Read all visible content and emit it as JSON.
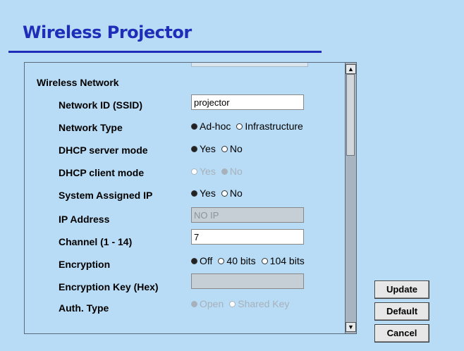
{
  "header": {
    "title": "Wireless Projector"
  },
  "section": {
    "heading": "Wireless Network"
  },
  "fields": {
    "ssid": {
      "label": "Network ID (SSID)",
      "value": "projector"
    },
    "network_type": {
      "label": "Network Type",
      "options": [
        "Ad-hoc",
        "Infrastructure"
      ],
      "selected": "Ad-hoc"
    },
    "dhcp_server": {
      "label": "DHCP server mode",
      "options": [
        "Yes",
        "No"
      ],
      "selected": "Yes"
    },
    "dhcp_client": {
      "label": "DHCP client mode",
      "options": [
        "Yes",
        "No"
      ],
      "selected": "No",
      "disabled": true
    },
    "system_ip": {
      "label": "System Assigned IP",
      "options": [
        "Yes",
        "No"
      ],
      "selected": "Yes"
    },
    "ip_address": {
      "label": "IP Address",
      "value": "NO IP",
      "disabled": true
    },
    "channel": {
      "label": "Channel (1 - 14)",
      "value": "7"
    },
    "encryption": {
      "label": "Encryption",
      "options": [
        "Off",
        "40 bits",
        "104 bits"
      ],
      "selected": "Off"
    },
    "encryption_key": {
      "label": "Encryption Key (Hex)",
      "value": "",
      "disabled": true
    },
    "auth_type": {
      "label": "Auth. Type",
      "options": [
        "Open",
        "Shared Key"
      ],
      "selected": "Open",
      "disabled": true
    }
  },
  "buttons": {
    "update": "Update",
    "default": "Default",
    "cancel": "Cancel"
  },
  "icons": {
    "scroll_up": "arrow-up-icon",
    "scroll_down": "arrow-down-icon"
  }
}
